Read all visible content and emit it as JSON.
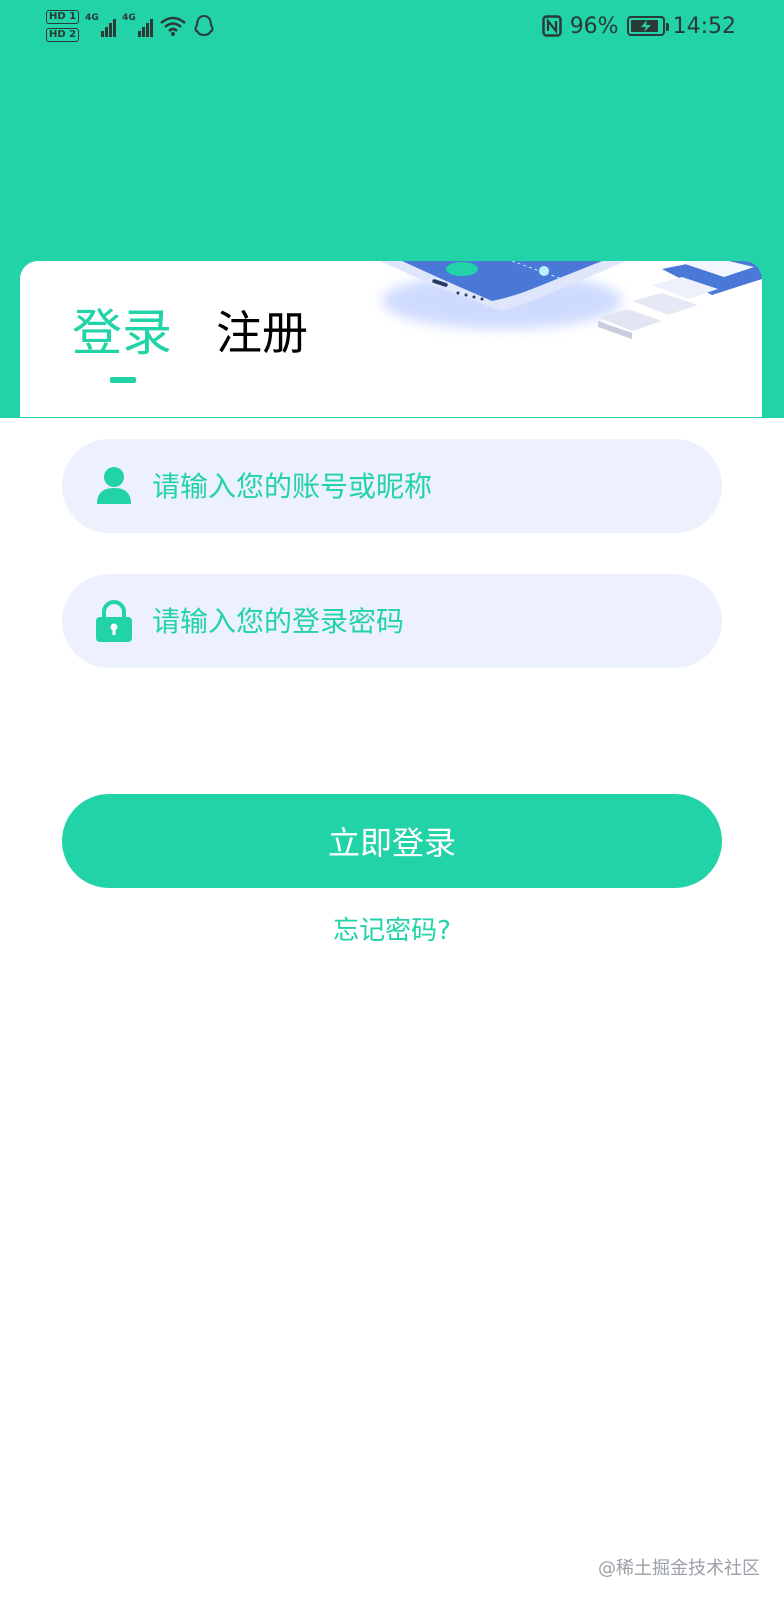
{
  "status_bar": {
    "hd1": "HD 1",
    "hd2": "HD 2",
    "network1": "4G",
    "network2": "4G",
    "battery_percent": "96%",
    "battery_level": 0.96,
    "time": "14:52",
    "icons": [
      "signal-icon",
      "wifi-icon",
      "qq-icon",
      "nfc-icon",
      "battery-charging-icon"
    ]
  },
  "theme": {
    "accent": "#22D3A8",
    "input_bg": "#EDF0FD",
    "illustration_blue": "#4A78D6"
  },
  "tabs": {
    "login": "登录",
    "register": "注册",
    "active": "login"
  },
  "form": {
    "username": {
      "placeholder": "请输入您的账号或昵称",
      "value": "",
      "icon": "user-icon"
    },
    "password": {
      "placeholder": "请输入您的登录密码",
      "value": "",
      "icon": "lock-icon"
    },
    "submit_label": "立即登录",
    "forgot_label": "忘记密码?"
  },
  "watermark": "@稀土掘金技术社区"
}
